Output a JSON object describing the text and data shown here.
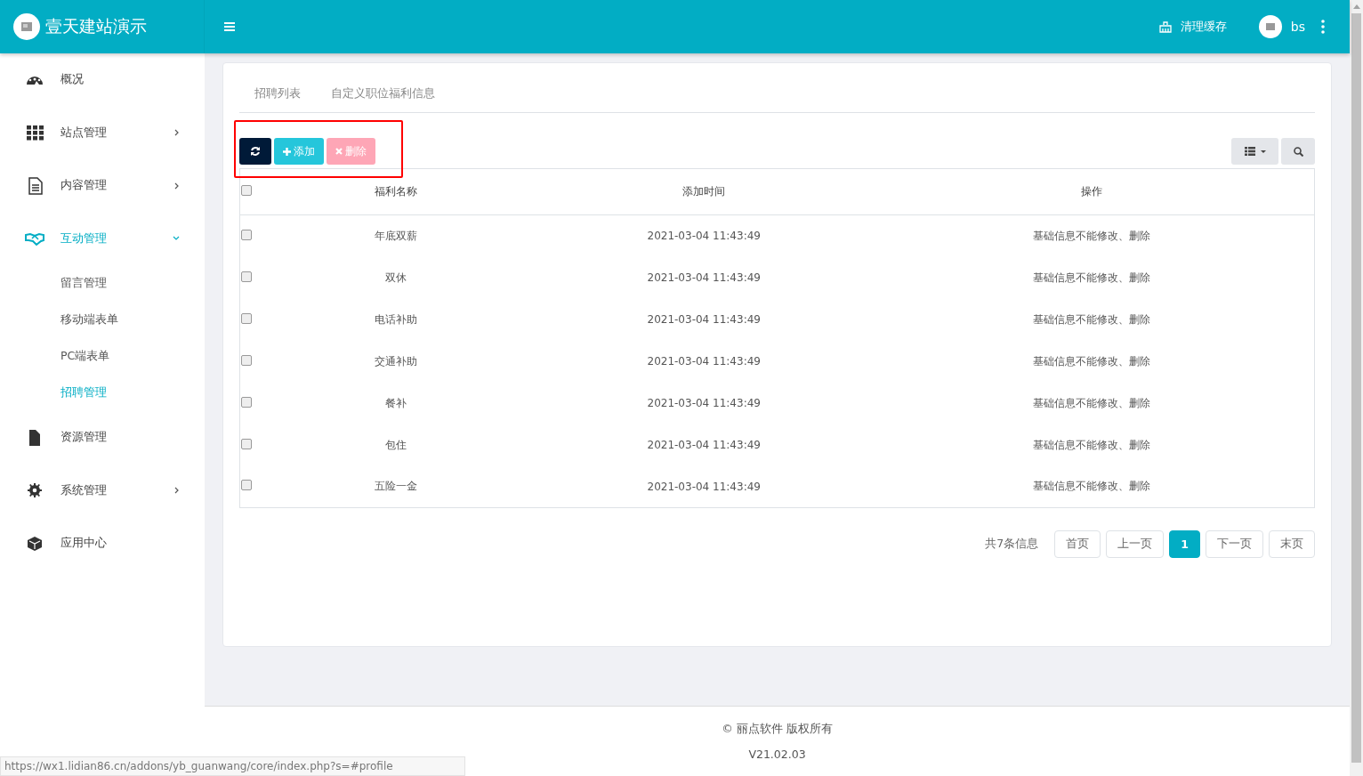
{
  "header": {
    "brand": "壹天建站演示",
    "clear_cache": "清理缓存",
    "user": "bs"
  },
  "sidebar": {
    "items": [
      {
        "label": "概况",
        "kind": "link",
        "selected": false
      },
      {
        "label": "站点管理",
        "kind": "group",
        "expanded": false,
        "selected": false
      },
      {
        "label": "内容管理",
        "kind": "group",
        "expanded": false,
        "selected": false
      },
      {
        "label": "互动管理",
        "kind": "group",
        "expanded": true,
        "selected": true,
        "children": [
          {
            "label": "留言管理",
            "selected": false
          },
          {
            "label": "移动端表单",
            "selected": false
          },
          {
            "label": "PC端表单",
            "selected": false
          },
          {
            "label": "招聘管理",
            "selected": true
          }
        ]
      },
      {
        "label": "资源管理",
        "kind": "link",
        "selected": false
      },
      {
        "label": "系统管理",
        "kind": "group",
        "expanded": false,
        "selected": false
      },
      {
        "label": "应用中心",
        "kind": "link",
        "selected": false
      }
    ]
  },
  "tabs": [
    {
      "label": "招聘列表",
      "selected": false
    },
    {
      "label": "自定义职位福利信息",
      "selected": false
    }
  ],
  "toolbar": {
    "add": "添加",
    "delete": "删除",
    "delete_disabled": true
  },
  "table": {
    "header_checked": false,
    "columns": [
      "福利名称",
      "添加时间",
      "操作"
    ],
    "rows": [
      {
        "checked": false,
        "name": "年底双薪",
        "time": "2021-03-04 11:43:49",
        "action": "基础信息不能修改、删除"
      },
      {
        "checked": false,
        "name": "双休",
        "time": "2021-03-04 11:43:49",
        "action": "基础信息不能修改、删除"
      },
      {
        "checked": false,
        "name": "电话补助",
        "time": "2021-03-04 11:43:49",
        "action": "基础信息不能修改、删除"
      },
      {
        "checked": false,
        "name": "交通补助",
        "time": "2021-03-04 11:43:49",
        "action": "基础信息不能修改、删除"
      },
      {
        "checked": false,
        "name": "餐补",
        "time": "2021-03-04 11:43:49",
        "action": "基础信息不能修改、删除"
      },
      {
        "checked": false,
        "name": "包住",
        "time": "2021-03-04 11:43:49",
        "action": "基础信息不能修改、删除"
      },
      {
        "checked": false,
        "name": "五险一金",
        "time": "2021-03-04 11:43:49",
        "action": "基础信息不能修改、删除"
      }
    ]
  },
  "pagination": {
    "total": "共7条信息",
    "pages": [
      {
        "label": "首页",
        "selected": false
      },
      {
        "label": "上一页",
        "selected": false
      },
      {
        "label": "1",
        "selected": true
      },
      {
        "label": "下一页",
        "selected": false
      },
      {
        "label": "末页",
        "selected": false
      }
    ]
  },
  "footer": {
    "copyright": "© 丽点软件 版权所有",
    "version": "V21.02.03"
  },
  "status_url": "https://wx1.lidian86.cn/addons/yb_guanwang/core/index.php?s=#profile"
}
